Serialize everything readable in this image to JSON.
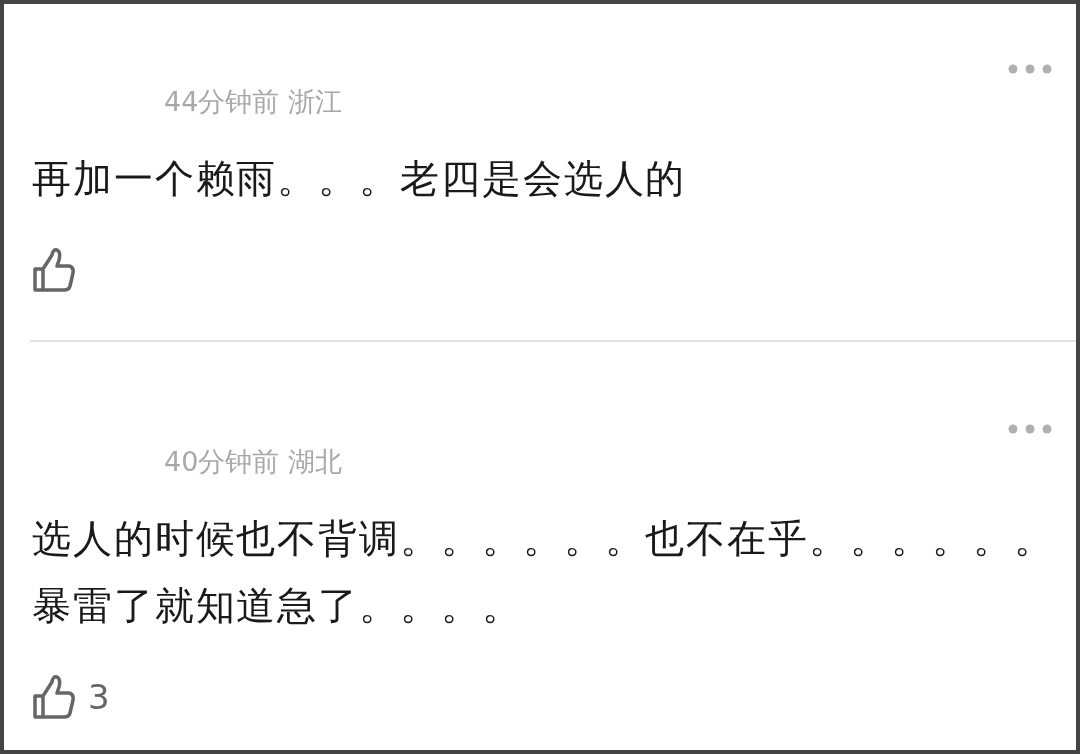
{
  "comments": [
    {
      "meta": "44分钟前 浙江",
      "text": "再加一个赖雨。。。老四是会选人的"
    },
    {
      "meta": "40分钟前 湖北",
      "text": "选人的时候也不背调。。。。。。也不在乎。。。。。。暴雷了就知道急了。。。。",
      "likes": "3"
    }
  ]
}
